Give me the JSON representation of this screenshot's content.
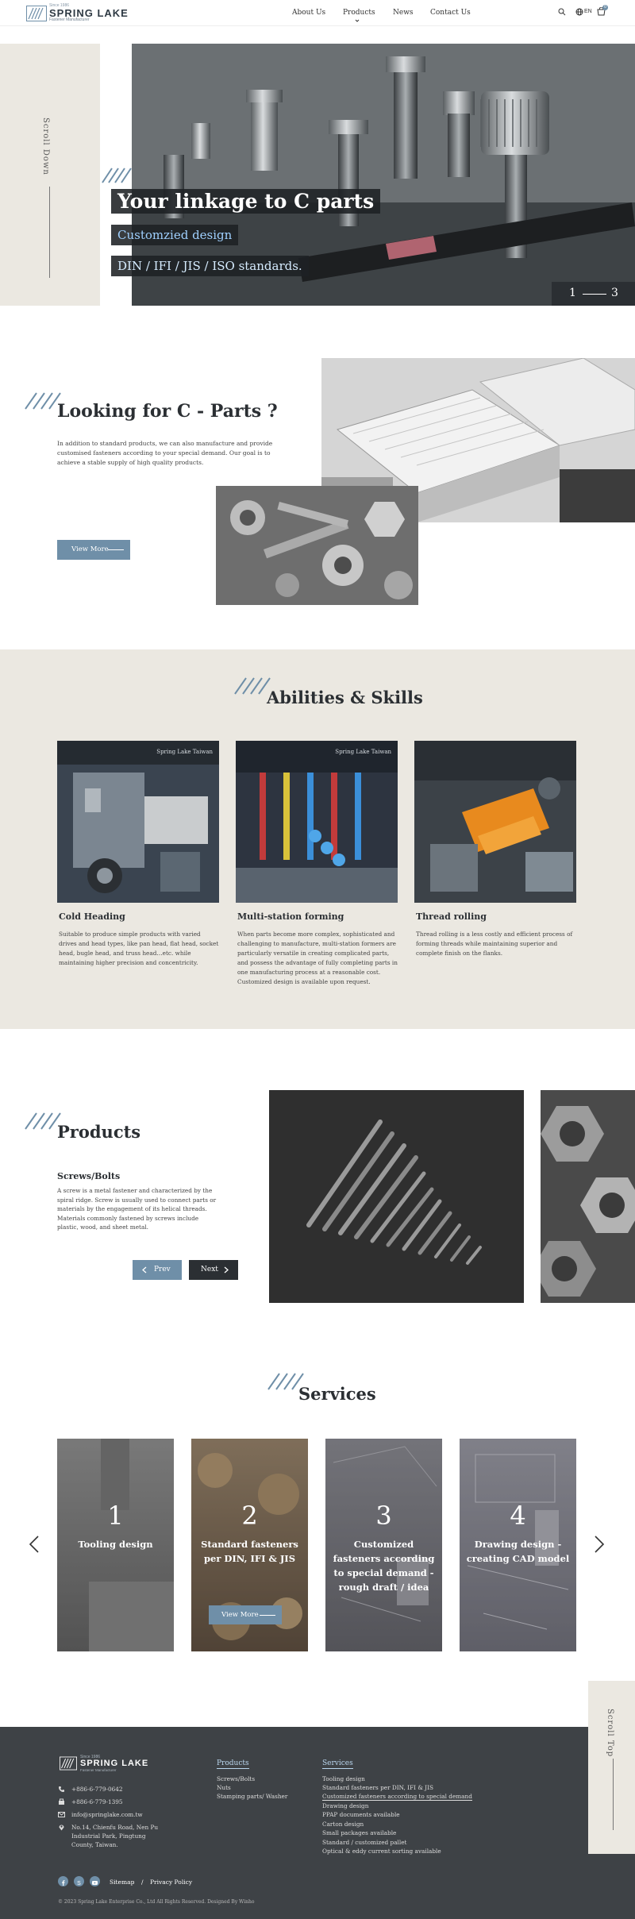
{
  "brand": {
    "since": "Since 1986",
    "name": "SPRING LAKE",
    "tagline": "Fastener Manufacturer"
  },
  "nav": {
    "items": [
      "About Us",
      "Products",
      "News",
      "Contact Us"
    ],
    "active": "Products",
    "lang": "EN",
    "cart_count": "0"
  },
  "hero": {
    "scroll_label": "Scroll Down",
    "title": "Your linkage to C parts",
    "line2": "Customzied design",
    "line3": "DIN / IFI / JIS / ISO standards.",
    "counter_current": "1",
    "counter_total": "3"
  },
  "looking": {
    "title": "Looking for  C - Parts ?",
    "body": "In addition to standard products, we can also manufacture and provide customised fasteners according to your special demand. Our goal is to achieve a stable supply of high quality products.",
    "button": "View More"
  },
  "abilities": {
    "title": "Abilities & Skills",
    "watermark": "Spring Lake Taiwan",
    "cards": [
      {
        "name": "Cold Heading",
        "desc": "Suitable to produce simple products with varied drives and head types, like pan head, flat head, socket head, bugle head, and truss head…etc. while maintaining higher precision and concentricity."
      },
      {
        "name": "Multi-station forming",
        "desc": "When parts become more complex, sophisticated and challenging to manufacture, multi-station formers are particularly versatile in creating complicated parts, and possess the advantage of fully completing parts in one manufacturing process at a reasonable cost. Customized design is available upon request."
      },
      {
        "name": "Thread rolling",
        "desc": "Thread rolling is a less costly and efficient process of forming threads while maintaining superior and complete finish on the flanks."
      }
    ]
  },
  "products": {
    "title": "Products",
    "subtitle": "Screws/Bolts",
    "body": "A screw is a metal fastener and characterized by the spiral ridge. Screw is usually used to connect parts or materials by the engagement of its helical threads. Materials commonly fastened by screws include plastic, wood, and sheet metal.",
    "prev": "Prev",
    "next": "Next"
  },
  "services": {
    "title": "Services",
    "button": "View More",
    "cards": [
      {
        "num": "1",
        "label": "Tooling design"
      },
      {
        "num": "2",
        "label": "Standard fasteners per DIN, IFI & JIS"
      },
      {
        "num": "3",
        "label": "Customized fasteners according to special demand - rough draft / idea"
      },
      {
        "num": "4",
        "label": "Drawing design - creating CAD model"
      }
    ]
  },
  "footer": {
    "scroll_top": "Scroll Top",
    "phone": "+886-6-779-0642",
    "fax": "+886-6-779-1395",
    "email": "info@springlake.com.tw",
    "address": [
      "No.14, Chienfu Road, Nen Pu",
      "Industrial Park, Pingtung",
      "County, Taiwan."
    ],
    "products_head": "Products",
    "products": [
      "Screws/Bolts",
      "Nuts",
      "Stamping parts/ Washer"
    ],
    "services_head": "Services",
    "services": [
      "Tooling design",
      "Standard fasteners per DIN, IFI & JIS",
      "Customized fasteners according to special demand",
      "Drawing design",
      "PPAP documents available",
      "Carton design",
      "Small packages available",
      "Standard / customized pallet",
      "Optical & eddy current sorting available"
    ],
    "sitemap": "Sitemap",
    "separator": "/",
    "privacy": "Privacy Policy",
    "copyright": "© 2023 Spring Lake Enterprise Co., Ltd All Rights Reserved. Designed By Winho"
  }
}
